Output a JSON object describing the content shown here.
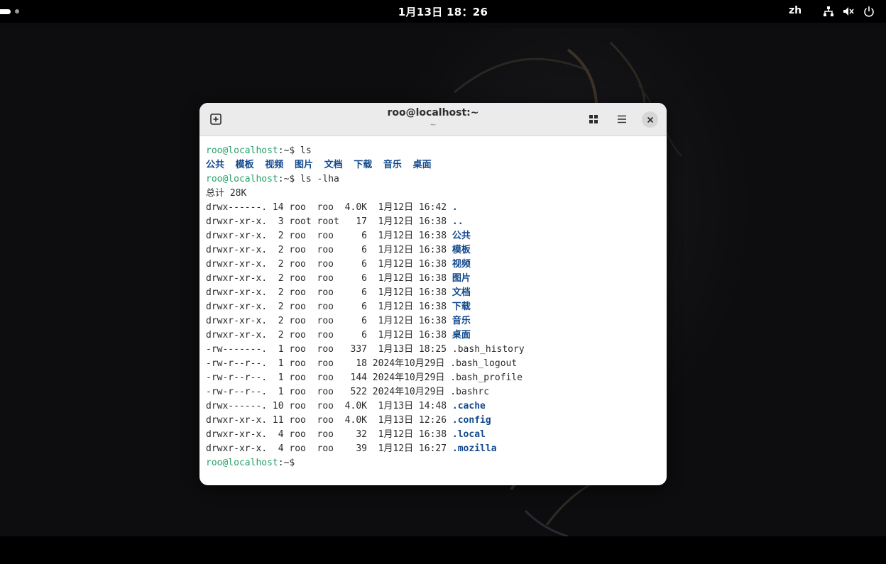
{
  "topbar": {
    "clock": "1月13日 18：26",
    "lang": "zh",
    "icons": [
      "network-icon",
      "volume-muted-icon",
      "power-icon"
    ]
  },
  "terminal": {
    "title": "roo@localhost:~",
    "subtitle": "~",
    "prompt_user": "roo@localhost",
    "prompt_suffix": ":~$",
    "lines": [
      {
        "type": "prompt",
        "cmd": " ls"
      },
      {
        "type": "dirs",
        "text": "公共  模板  视频  图片  文档  下载  音乐  桌面"
      },
      {
        "type": "prompt",
        "cmd": " ls -lha"
      },
      {
        "type": "text",
        "text": "总计 28K"
      },
      {
        "type": "entry",
        "meta": "drwx------. 14 roo  roo  4.0K  1月12日 16:42 ",
        "name": ".",
        "dir": true
      },
      {
        "type": "entry",
        "meta": "drwxr-xr-x.  3 root root   17  1月12日 16:38 ",
        "name": "..",
        "dir": true
      },
      {
        "type": "entry",
        "meta": "drwxr-xr-x.  2 roo  roo     6  1月12日 16:38 ",
        "name": "公共",
        "dir": true
      },
      {
        "type": "entry",
        "meta": "drwxr-xr-x.  2 roo  roo     6  1月12日 16:38 ",
        "name": "模板",
        "dir": true
      },
      {
        "type": "entry",
        "meta": "drwxr-xr-x.  2 roo  roo     6  1月12日 16:38 ",
        "name": "视频",
        "dir": true
      },
      {
        "type": "entry",
        "meta": "drwxr-xr-x.  2 roo  roo     6  1月12日 16:38 ",
        "name": "图片",
        "dir": true
      },
      {
        "type": "entry",
        "meta": "drwxr-xr-x.  2 roo  roo     6  1月12日 16:38 ",
        "name": "文档",
        "dir": true
      },
      {
        "type": "entry",
        "meta": "drwxr-xr-x.  2 roo  roo     6  1月12日 16:38 ",
        "name": "下载",
        "dir": true
      },
      {
        "type": "entry",
        "meta": "drwxr-xr-x.  2 roo  roo     6  1月12日 16:38 ",
        "name": "音乐",
        "dir": true
      },
      {
        "type": "entry",
        "meta": "drwxr-xr-x.  2 roo  roo     6  1月12日 16:38 ",
        "name": "桌面",
        "dir": true
      },
      {
        "type": "entry",
        "meta": "-rw-------.  1 roo  roo   337  1月13日 18:25 ",
        "name": ".bash_history",
        "dir": false
      },
      {
        "type": "entry",
        "meta": "-rw-r--r--.  1 roo  roo    18 2024年10月29日 ",
        "name": ".bash_logout",
        "dir": false
      },
      {
        "type": "entry",
        "meta": "-rw-r--r--.  1 roo  roo   144 2024年10月29日 ",
        "name": ".bash_profile",
        "dir": false
      },
      {
        "type": "entry",
        "meta": "-rw-r--r--.  1 roo  roo   522 2024年10月29日 ",
        "name": ".bashrc",
        "dir": false
      },
      {
        "type": "entry",
        "meta": "drwx------. 10 roo  roo  4.0K  1月13日 14:48 ",
        "name": ".cache",
        "dir": true
      },
      {
        "type": "entry",
        "meta": "drwxr-xr-x. 11 roo  roo  4.0K  1月13日 12:26 ",
        "name": ".config",
        "dir": true
      },
      {
        "type": "entry",
        "meta": "drwxr-xr-x.  4 roo  roo    32  1月12日 16:38 ",
        "name": ".local",
        "dir": true
      },
      {
        "type": "entry",
        "meta": "drwxr-xr-x.  4 roo  roo    39  1月12日 16:27 ",
        "name": ".mozilla",
        "dir": true
      },
      {
        "type": "prompt",
        "cmd": ""
      }
    ]
  },
  "colors": {
    "prompt_user": "#26a269",
    "directory": "#12488b",
    "text": "#2b2b2b"
  }
}
